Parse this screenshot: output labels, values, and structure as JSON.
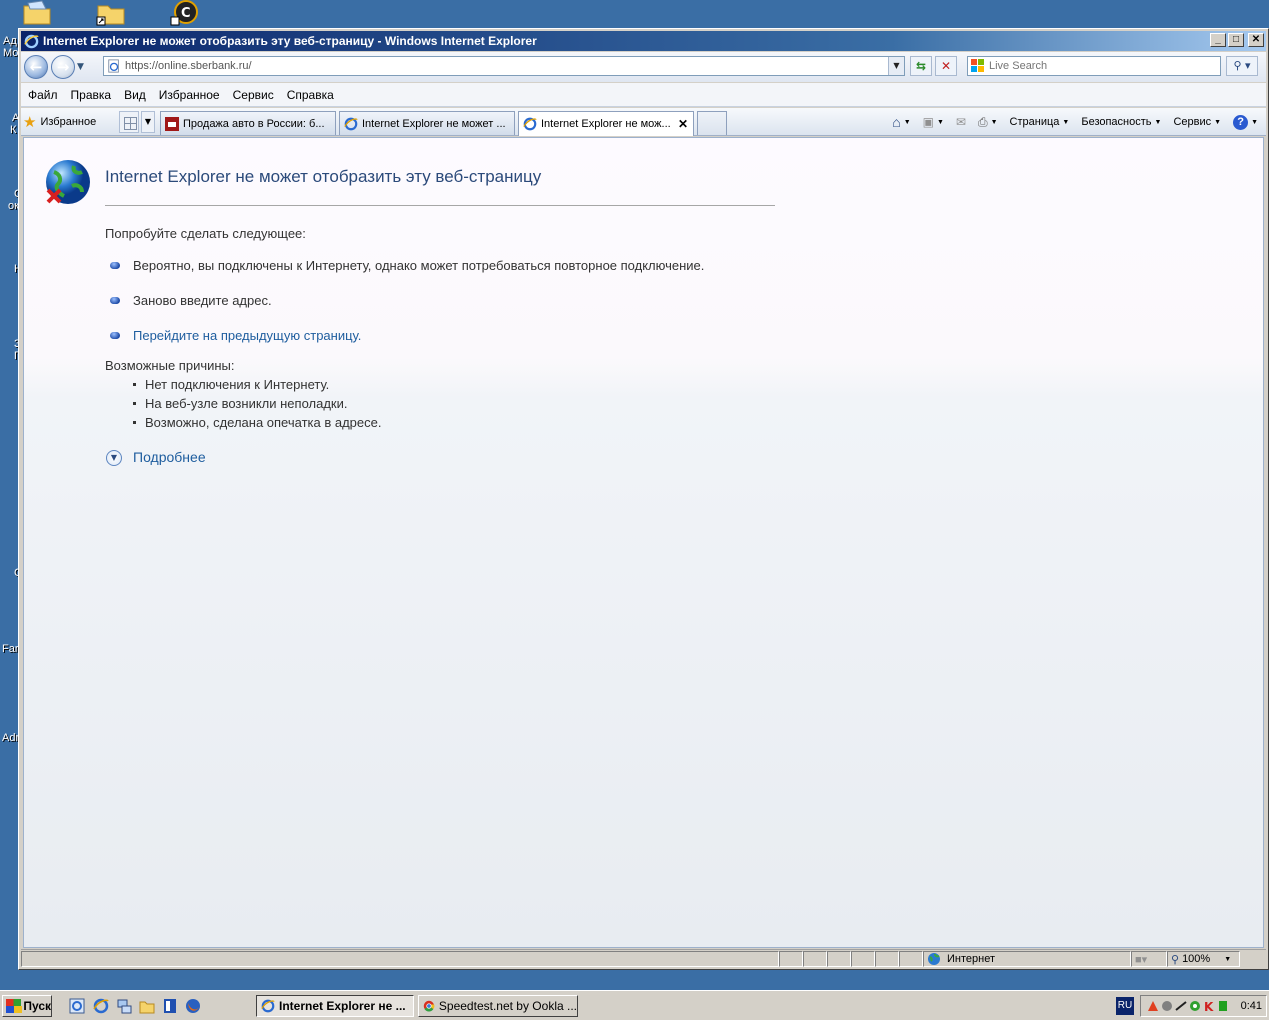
{
  "desktop": {
    "labels": [
      "Ад",
      "Мо",
      "А",
      "К",
      "С",
      "ок",
      "Н",
      "З",
      "П",
      "С",
      "Far",
      "Adr"
    ]
  },
  "window": {
    "title": "Internet Explorer не может отобразить эту веб-страницу - Windows Internet Explorer",
    "min": "_",
    "max": "□",
    "close": "✕"
  },
  "address": {
    "url": "https://online.sberbank.ru/",
    "search_placeholder": "Live Search"
  },
  "menu": {
    "items": [
      "Файл",
      "Правка",
      "Вид",
      "Избранное",
      "Сервис",
      "Справка"
    ]
  },
  "tabs": {
    "favorites": "Избранное",
    "items": [
      {
        "label": "Продажа авто в России: б..."
      },
      {
        "label": "Internet Explorer не может ..."
      },
      {
        "label": "Internet Explorer не мож..."
      }
    ],
    "commands": {
      "page": "Страница",
      "safety": "Безопасность",
      "tools": "Сервис"
    }
  },
  "content": {
    "heading": "Internet Explorer не может отобразить эту веб-страницу",
    "try_label": "Попробуйте сделать следующее:",
    "suggestions": [
      "Вероятно, вы подключены к Интернету, однако может потребоваться повторное подключение.",
      "Заново введите адрес.",
      "Перейдите на предыдущую страницу."
    ],
    "causes_label": "Возможные причины:",
    "causes": [
      "Нет подключения к Интернету.",
      "На веб-узле возникли неполадки.",
      "Возможно, сделана опечатка в адресе."
    ],
    "more": "Подробнее"
  },
  "status": {
    "zone": "Интернет",
    "zoom": "100%"
  },
  "taskbar": {
    "start": "Пуск",
    "windows": [
      {
        "label": "Internet Explorer не ..."
      },
      {
        "label": "Speedtest.net by Ookla ..."
      }
    ],
    "lang": "RU",
    "clock": "0:41"
  }
}
